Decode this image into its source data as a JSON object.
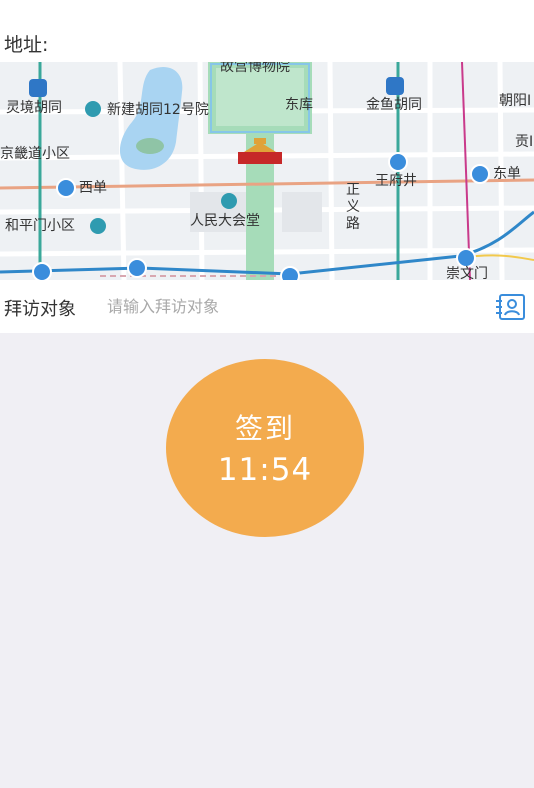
{
  "address": {
    "label": "地址:"
  },
  "map": {
    "pois": {
      "palace_museum": "故宫博物院",
      "lingjing": "灵境胡同",
      "xinjian": "新建胡同12号院",
      "dongku": "东库",
      "jinyu": "金鱼胡同",
      "chaoyang": "朝阳I",
      "jingcang": "京畿道小区",
      "gong": "贡I",
      "xidan": "西单",
      "wangfujing": "王府井",
      "dongdan": "东单",
      "heping": "和平门小区",
      "great_hall": "人民大会堂",
      "zhengyi": [
        "正",
        "义",
        "路"
      ],
      "chongwen": "崇文门"
    }
  },
  "visitor": {
    "label": "拜访对象",
    "placeholder": "请输入拜访对象",
    "value": ""
  },
  "checkin": {
    "label": "签到",
    "time": "11:54"
  },
  "colors": {
    "accent": "#f3ab4e",
    "link_blue": "#3a8ddc",
    "page_bg": "#f0eff4"
  }
}
